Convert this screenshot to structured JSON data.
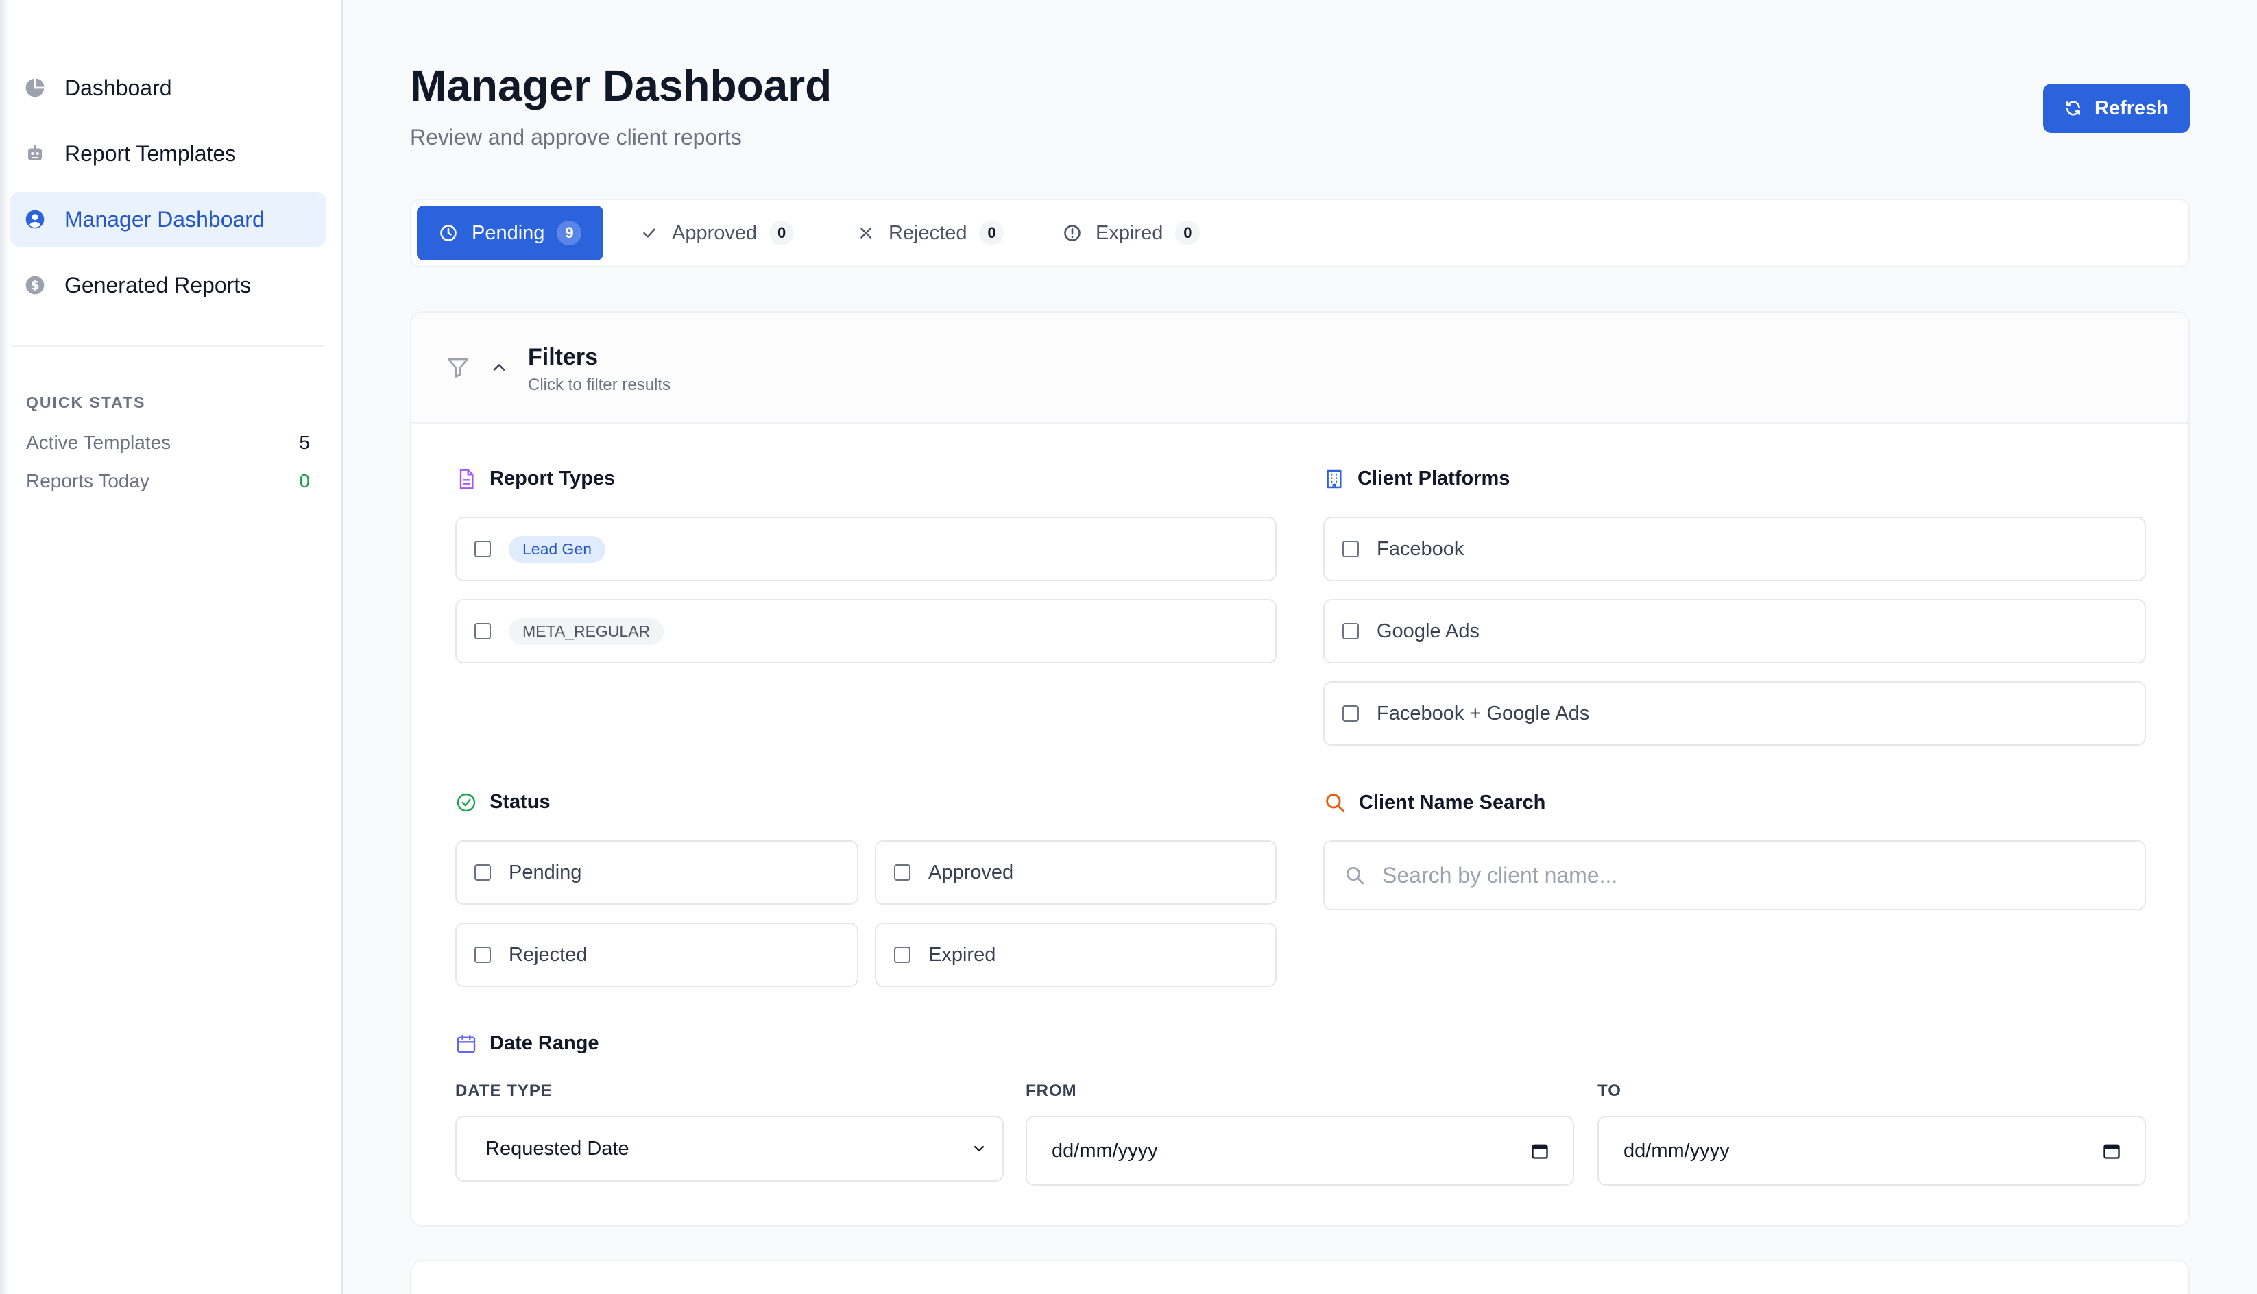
{
  "sidebar": {
    "items": [
      {
        "label": "Dashboard",
        "icon": "pie-chart-icon"
      },
      {
        "label": "Report Templates",
        "icon": "robot-icon"
      },
      {
        "label": "Manager Dashboard",
        "icon": "user-circle-icon"
      },
      {
        "label": "Generated Reports",
        "icon": "dollar-icon"
      }
    ],
    "active_item": "Manager Dashboard",
    "quick_stats": {
      "title": "QUICK STATS",
      "active_templates_label": "Active Templates",
      "active_templates_value": "5",
      "reports_today_label": "Reports Today",
      "reports_today_value": "0"
    }
  },
  "header": {
    "title": "Manager Dashboard",
    "subtitle": "Review and approve client reports",
    "refresh_label": "Refresh"
  },
  "tabs": [
    {
      "label": "Pending",
      "count": "9",
      "active": true
    },
    {
      "label": "Approved",
      "count": "0"
    },
    {
      "label": "Rejected",
      "count": "0"
    },
    {
      "label": "Expired",
      "count": "0"
    }
  ],
  "filters": {
    "title": "Filters",
    "subtitle": "Click to filter results",
    "report_types": {
      "label": "Report Types",
      "options": [
        "Lead Gen",
        "META_REGULAR"
      ]
    },
    "client_platforms": {
      "label": "Client Platforms",
      "options": [
        "Facebook",
        "Google Ads",
        "Facebook + Google Ads"
      ]
    },
    "status": {
      "label": "Status",
      "options": [
        "Pending",
        "Approved",
        "Rejected",
        "Expired"
      ]
    },
    "client_search": {
      "label": "Client Name Search",
      "placeholder": "Search by client name..."
    },
    "date_range": {
      "label": "Date Range",
      "date_type_label": "DATE TYPE",
      "date_type_value": "Requested Date",
      "from_label": "FROM",
      "from_value": "dd/mm/yyyy",
      "to_label": "TO",
      "to_value": "dd/mm/yyyy"
    }
  },
  "colors": {
    "accent": "#2b63dc",
    "active_bg": "#eaf2fe",
    "success": "#16a34a"
  }
}
